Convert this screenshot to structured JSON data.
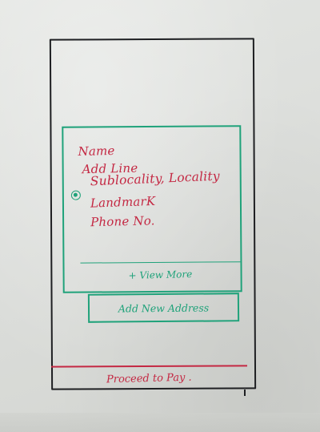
{
  "address_card": {
    "name": "Name",
    "address_line": "Add Line",
    "locality": "Sublocality, Locality",
    "landmark": "LandmarK",
    "phone": "Phone No.",
    "selected": true
  },
  "view_more": {
    "label": "+ View More"
  },
  "add_address": {
    "label": "Add New Address"
  },
  "footer": {
    "proceed_label": "Proceed to Pay ."
  },
  "colors": {
    "accent_green": "#1fa27a",
    "accent_red": "#c42843",
    "frame": "#1e1f22"
  }
}
